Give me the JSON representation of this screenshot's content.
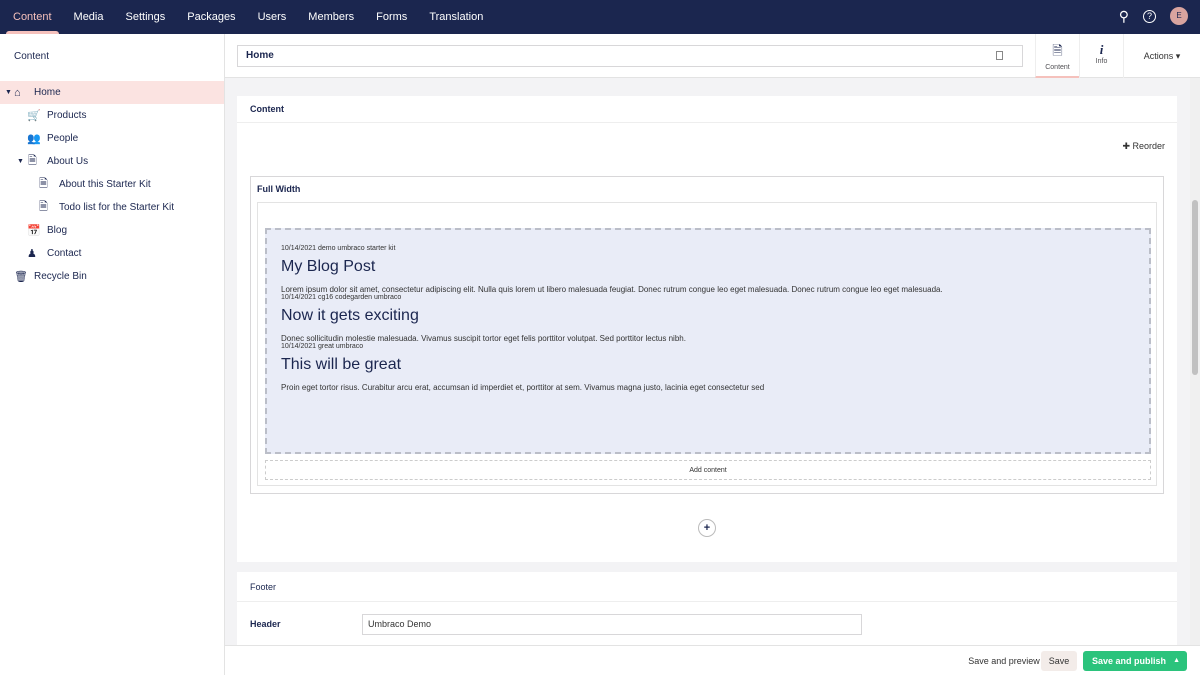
{
  "topnav": {
    "items": [
      "Content",
      "Media",
      "Settings",
      "Packages",
      "Users",
      "Members",
      "Forms",
      "Translation"
    ],
    "avatar": "E"
  },
  "sidebar": {
    "title": "Content",
    "items": [
      {
        "label": "Home",
        "icon": "home-icon"
      },
      {
        "label": "Products",
        "icon": "cart-icon"
      },
      {
        "label": "People",
        "icon": "users-icon"
      },
      {
        "label": "About Us",
        "icon": "document-icon"
      },
      {
        "label": "About this Starter Kit",
        "icon": "document-icon"
      },
      {
        "label": "Todo list for the Starter Kit",
        "icon": "document-icon"
      },
      {
        "label": "Blog",
        "icon": "calendar-icon"
      },
      {
        "label": "Contact",
        "icon": "contact-icon"
      },
      {
        "label": "Recycle Bin",
        "icon": "trash-icon"
      }
    ]
  },
  "header": {
    "name": "Home",
    "apps": [
      "Content",
      "Info"
    ],
    "actions": "Actions"
  },
  "content": {
    "title": "Content",
    "reorder": "Reorder",
    "row_title": "Full Width",
    "add_content": "Add content",
    "posts": [
      {
        "meta": "10/14/2021 demo umbraco starter kit",
        "title": "My Blog Post",
        "text": "Lorem ipsum dolor sit amet, consectetur adipiscing elit. Nulla quis lorem ut libero malesuada feugiat. Donec rutrum congue leo eget malesuada. Donec rutrum congue leo eget malesuada."
      },
      {
        "meta": "10/14/2021 cg16 codegarden umbraco",
        "title": "Now it gets exciting",
        "text": "Donec sollicitudin molestie malesuada. Vivamus suscipit tortor eget felis porttitor volutpat. Sed porttitor lectus nibh."
      },
      {
        "meta": "10/14/2021 great umbraco",
        "title": "This will be great",
        "text": "Proin eget tortor risus. Curabitur arcu erat, accumsan id imperdiet et, porttitor at sem. Vivamus magna justo, lacinia eget consectetur sed"
      }
    ]
  },
  "footer": {
    "title": "Footer",
    "header_label": "Header",
    "header_value": "Umbraco Demo"
  },
  "buttons": {
    "preview": "Save and preview",
    "save": "Save",
    "publish": "Save and publish"
  }
}
